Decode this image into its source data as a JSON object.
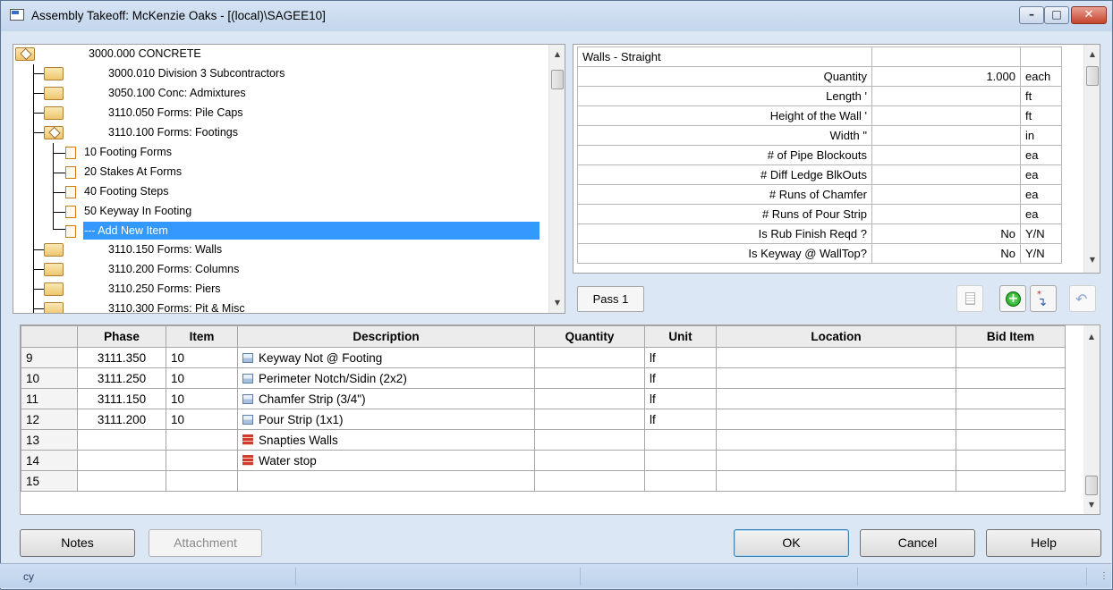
{
  "window": {
    "title": "Assembly Takeoff:  McKenzie Oaks - [(local)\\SAGEE10]"
  },
  "tree": {
    "items": [
      "3000.000 CONCRETE",
      "3000.010 Division 3 Subcontractors",
      "3050.100 Conc: Admixtures",
      "3110.050 Forms: Pile Caps",
      "3110.100 Forms: Footings",
      "10 Footing Forms",
      "20 Stakes At Forms",
      "40 Footing Steps",
      "50 Keyway In Footing",
      "--- Add New Item",
      "3110.150 Forms: Walls",
      "3110.200 Forms: Columns",
      "3110.250 Forms: Piers",
      "3110.300 Forms: Pit & Misc"
    ]
  },
  "props": {
    "header": "Walls - Straight",
    "rows": [
      {
        "label": "Quantity",
        "value": "1.000",
        "unit": "each"
      },
      {
        "label": "Length '",
        "value": "",
        "unit": "ft"
      },
      {
        "label": "Height of the Wall '",
        "value": "",
        "unit": "ft"
      },
      {
        "label": "Width \"",
        "value": "",
        "unit": "in"
      },
      {
        "label": "# of Pipe Blockouts",
        "value": "",
        "unit": "ea"
      },
      {
        "label": "# Diff Ledge BlkOuts",
        "value": "",
        "unit": "ea"
      },
      {
        "label": "# Runs of Chamfer",
        "value": "",
        "unit": "ea"
      },
      {
        "label": "# Runs of Pour Strip",
        "value": "",
        "unit": "ea"
      },
      {
        "label": "Is Rub Finish Reqd ?",
        "value": "No",
        "unit": "Y/N"
      },
      {
        "label": "Is Keyway @ WallTop?",
        "value": "No",
        "unit": "Y/N"
      }
    ],
    "pass_tab": "Pass 1"
  },
  "grid": {
    "headers": [
      "Phase",
      "Item",
      "Description",
      "Quantity",
      "Unit",
      "Location",
      "Bid Item"
    ],
    "rows": [
      {
        "n": "9",
        "phase": "3111.350",
        "item": "10",
        "desc": "Keyway Not @ Footing",
        "qty": "",
        "unit": "lf",
        "loc": "",
        "bid": "",
        "icon": "item-icon"
      },
      {
        "n": "10",
        "phase": "3111.250",
        "item": "10",
        "desc": "Perimeter Notch/Sidin (2x2)",
        "qty": "",
        "unit": "lf",
        "loc": "",
        "bid": "",
        "icon": "item-icon"
      },
      {
        "n": "11",
        "phase": "3111.150",
        "item": "10",
        "desc": "Chamfer Strip (3/4\")",
        "qty": "",
        "unit": "lf",
        "loc": "",
        "bid": "",
        "icon": "item-icon"
      },
      {
        "n": "12",
        "phase": "3111.200",
        "item": "10",
        "desc": "Pour Strip (1x1)",
        "qty": "",
        "unit": "lf",
        "loc": "",
        "bid": "",
        "icon": "item-icon"
      },
      {
        "n": "13",
        "phase": "",
        "item": "",
        "desc": "Snapties Walls",
        "qty": "",
        "unit": "",
        "loc": "",
        "bid": "",
        "icon": "assembly-icon"
      },
      {
        "n": "14",
        "phase": "",
        "item": "",
        "desc": "Water stop",
        "qty": "",
        "unit": "",
        "loc": "",
        "bid": "",
        "icon": "assembly-icon"
      },
      {
        "n": "15",
        "phase": "",
        "item": "",
        "desc": "",
        "qty": "",
        "unit": "",
        "loc": "",
        "bid": "",
        "icon": ""
      }
    ]
  },
  "buttons": {
    "notes": "Notes",
    "attachment": "Attachment",
    "ok": "OK",
    "cancel": "Cancel",
    "help": "Help"
  },
  "status": {
    "left": "cy"
  }
}
